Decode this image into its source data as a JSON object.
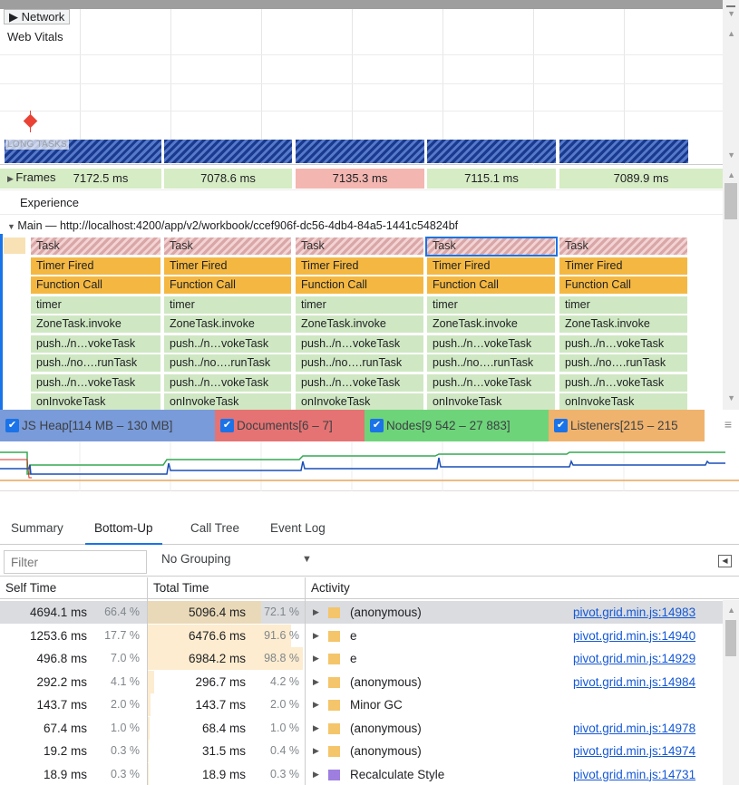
{
  "top": {
    "network_label": "Network",
    "web_vitals_label": "Web Vitals",
    "long_tasks_label": "LONG TASKS"
  },
  "frames": {
    "label": "Frames",
    "cells": [
      "7172.5 ms",
      "7078.6 ms",
      "7135.3 ms",
      "7115.1 ms",
      "7089.9 ms"
    ]
  },
  "experience_label": "Experience",
  "main": {
    "title": "Main — http://localhost:4200/app/v2/workbook/ccef906f-dc56-4db4-84a5-1441c54824bf",
    "rows": [
      [
        "Task",
        "Task",
        "Task",
        "Task",
        "Task"
      ],
      [
        "Timer Fired",
        "Timer Fired",
        "Timer Fired",
        "Timer Fired",
        "Timer Fired"
      ],
      [
        "Function Call",
        "Function Call",
        "Function Call",
        "Function Call",
        "Function Call"
      ],
      [
        "timer",
        "timer",
        "timer",
        "timer",
        "timer"
      ],
      [
        "ZoneTask.invoke",
        "ZoneTask.invoke",
        "ZoneTask.invoke",
        "ZoneTask.invoke",
        "ZoneTask.invoke"
      ],
      [
        "push../n…vokeTask",
        "push../n…vokeTask",
        "push../n…vokeTask",
        "push../n…vokeTask",
        "push../n…vokeTask"
      ],
      [
        "push../no….runTask",
        "push../no….runTask",
        "push../no….runTask",
        "push../no….runTask",
        "push../no….runTask"
      ],
      [
        "push../n…vokeTask",
        "push../n…vokeTask",
        "push../n…vokeTask",
        "push../n…vokeTask",
        "push../n…vokeTask"
      ],
      [
        "onInvokeTask",
        "onInvokeTask",
        "onInvokeTask",
        "onInvokeTask",
        "onInvokeTask"
      ]
    ]
  },
  "memory": {
    "items": [
      {
        "label": "JS Heap[114 MB – 130 MB]",
        "color": "#7a9bd9"
      },
      {
        "label": "Documents[6 – 7]",
        "color": "#e57373"
      },
      {
        "label": "Nodes[9 542 – 27 883]",
        "color": "#6ed47a"
      },
      {
        "label": "Listeners[215 – 215",
        "color": "#f0b36e"
      }
    ],
    "menu_icon": "hamburger-icon"
  },
  "tabs": [
    "Summary",
    "Bottom-Up",
    "Call Tree",
    "Event Log"
  ],
  "active_tab": "Bottom-Up",
  "filter": {
    "placeholder": "Filter",
    "grouping": "No Grouping"
  },
  "table": {
    "headers": {
      "self_time": "Self Time",
      "total_time": "Total Time",
      "activity": "Activity"
    },
    "rows": [
      {
        "self": "4694.1 ms",
        "self_pct": "66.4 %",
        "total": "5096.4 ms",
        "total_pct": "72.1 %",
        "total_frac": 0.721,
        "activity": "(anonymous)",
        "icon_color": "#f4c56a",
        "source": "pivot.grid.min.js:14983"
      },
      {
        "self": "1253.6 ms",
        "self_pct": "17.7 %",
        "total": "6476.6 ms",
        "total_pct": "91.6 %",
        "total_frac": 0.916,
        "activity": "e",
        "icon_color": "#f4c56a",
        "source": "pivot.grid.min.js:14940"
      },
      {
        "self": "496.8 ms",
        "self_pct": "7.0 %",
        "total": "6984.2 ms",
        "total_pct": "98.8 %",
        "total_frac": 0.988,
        "activity": "e",
        "icon_color": "#f4c56a",
        "source": "pivot.grid.min.js:14929"
      },
      {
        "self": "292.2 ms",
        "self_pct": "4.1 %",
        "total": "296.7 ms",
        "total_pct": "4.2 %",
        "total_frac": 0.042,
        "activity": "(anonymous)",
        "icon_color": "#f4c56a",
        "source": "pivot.grid.min.js:14984"
      },
      {
        "self": "143.7 ms",
        "self_pct": "2.0 %",
        "total": "143.7 ms",
        "total_pct": "2.0 %",
        "total_frac": 0.02,
        "activity": "Minor GC",
        "icon_color": "#f4c56a",
        "source": ""
      },
      {
        "self": "67.4 ms",
        "self_pct": "1.0 %",
        "total": "68.4 ms",
        "total_pct": "1.0 %",
        "total_frac": 0.01,
        "activity": "(anonymous)",
        "icon_color": "#f4c56a",
        "source": "pivot.grid.min.js:14978"
      },
      {
        "self": "19.2 ms",
        "self_pct": "0.3 %",
        "total": "31.5 ms",
        "total_pct": "0.4 %",
        "total_frac": 0.004,
        "activity": "(anonymous)",
        "icon_color": "#f4c56a",
        "source": "pivot.grid.min.js:14974"
      },
      {
        "self": "18.9 ms",
        "self_pct": "0.3 %",
        "total": "18.9 ms",
        "total_pct": "0.3 %",
        "total_frac": 0.003,
        "activity": "Recalculate Style",
        "icon_color": "#9e7fe0",
        "source": "pivot.grid.min.js:14731"
      }
    ]
  }
}
